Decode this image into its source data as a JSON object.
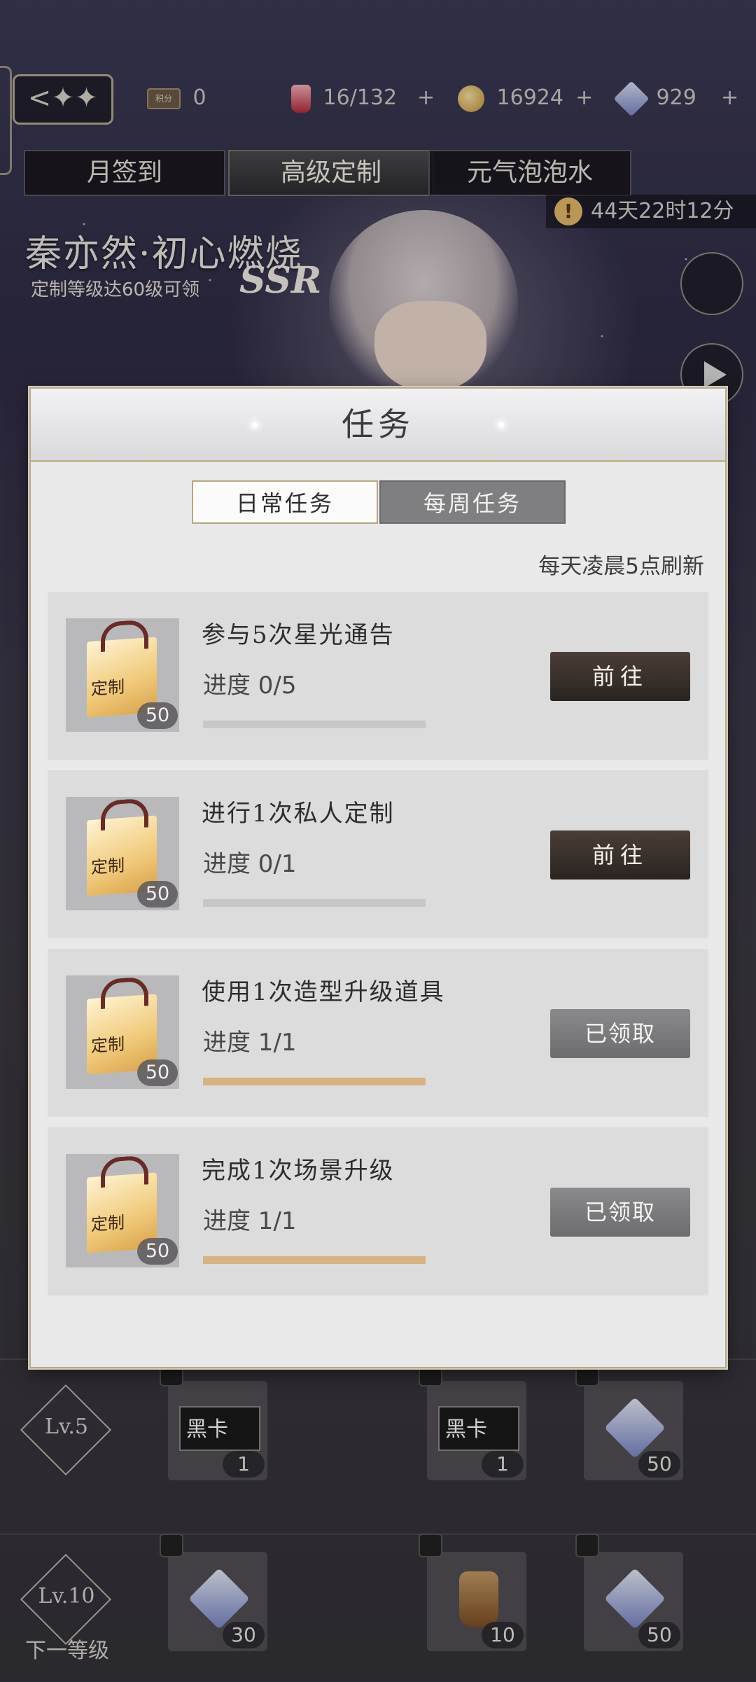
{
  "topbar": {
    "back_label": "<✦✦",
    "points_icon_text": "积分",
    "points": "0",
    "stamina": "16/132",
    "coins": "16924",
    "gems": "929",
    "plus": "+"
  },
  "tabs": [
    "月签到",
    "高级定制",
    "元气泡泡水"
  ],
  "active_tab": 1,
  "timer": {
    "warn": "!",
    "text": "44天22时12分"
  },
  "banner": {
    "title": "秦亦然·初心燃烧",
    "subtitle": "定制等级达60级可领",
    "rarity": "SSR"
  },
  "rewards": {
    "row1": {
      "level": "Lv.5",
      "items": [
        {
          "label": "黑卡",
          "count": "1"
        },
        {
          "label": "黑卡",
          "count": "1"
        },
        {
          "label": "",
          "count": "50"
        }
      ]
    },
    "row2": {
      "level": "Lv.10",
      "next_label": "下一等级",
      "items": [
        {
          "count": "30"
        },
        {
          "count": "10"
        },
        {
          "count": "50"
        }
      ]
    }
  },
  "modal": {
    "title": "任务",
    "tabs": {
      "daily": "日常任务",
      "weekly": "每周任务"
    },
    "refresh_note": "每天凌晨5点刷新",
    "bag_label": "定制",
    "tasks": [
      {
        "name": "参与5次星光通告",
        "progress": "进度 0/5",
        "reward": "50",
        "button": "前往",
        "state": "go",
        "fraction": 0
      },
      {
        "name": "进行1次私人定制",
        "progress": "进度 0/1",
        "reward": "50",
        "button": "前往",
        "state": "go",
        "fraction": 0
      },
      {
        "name": "使用1次造型升级道具",
        "progress": "进度 1/1",
        "reward": "50",
        "button": "已领取",
        "state": "done",
        "fraction": 1
      },
      {
        "name": "完成1次场景升级",
        "progress": "进度 1/1",
        "reward": "50",
        "button": "已领取",
        "state": "done",
        "fraction": 1
      }
    ]
  },
  "colors": {
    "accent_gold": "#d6b381",
    "go_button": "#2a2420",
    "done_button": "#7a797b"
  }
}
